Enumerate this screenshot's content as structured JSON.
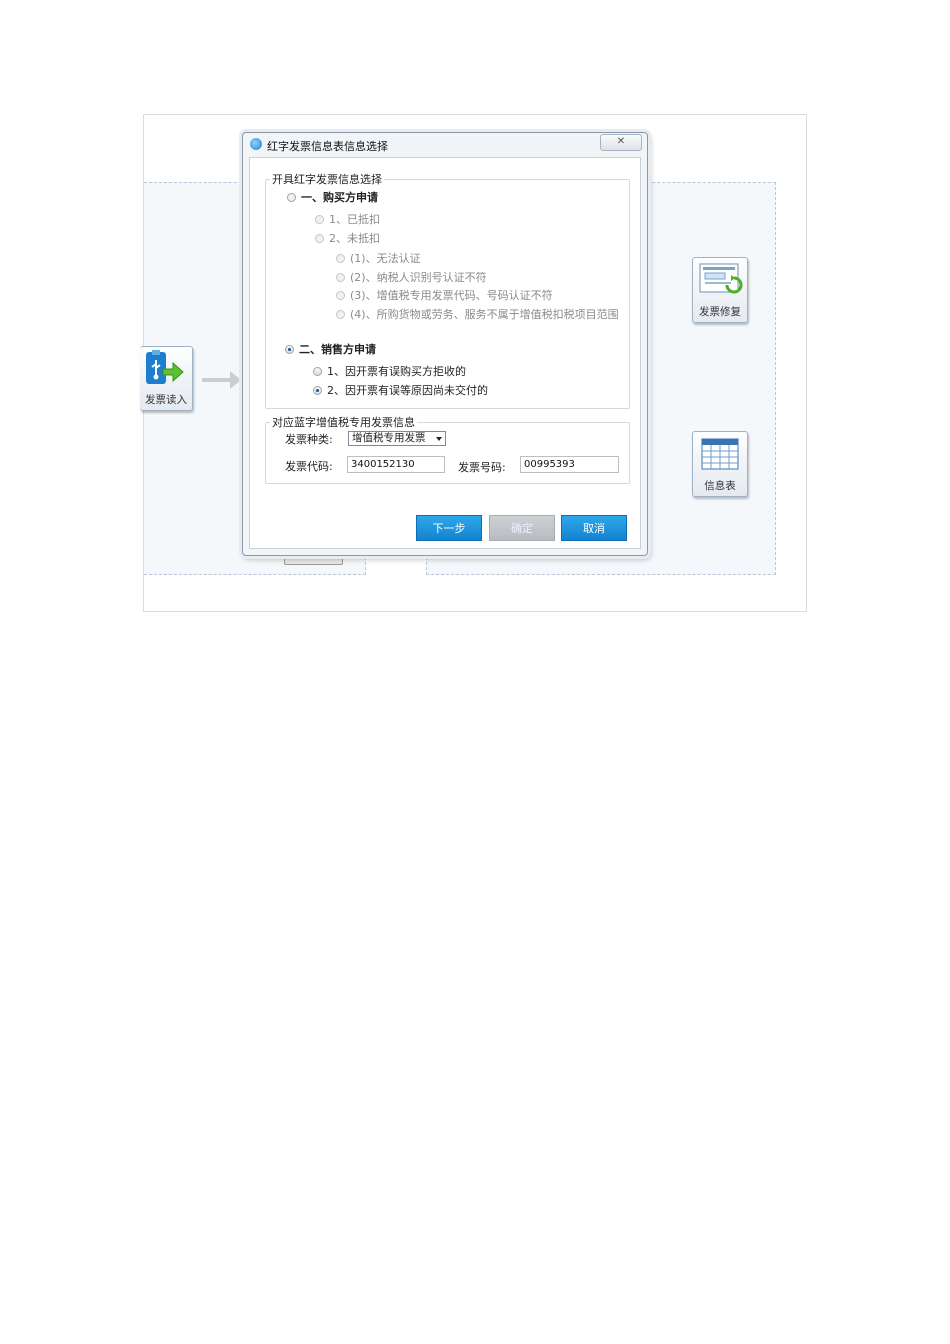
{
  "background": {
    "tiles": [
      {
        "label": "发票读入",
        "icon": "usb-import-icon"
      },
      {
        "label": "发票修复",
        "icon": "invoice-repair-icon"
      },
      {
        "label": "信息表",
        "icon": "table-icon"
      }
    ]
  },
  "dialog": {
    "title": "红字发票信息表信息选择",
    "group1": {
      "legend": "开具红字发票信息选择",
      "buyer": {
        "label": "一、购买方申请",
        "options": [
          "1、已抵扣",
          "2、未抵扣"
        ],
        "sub_options": [
          "(1)、无法认证",
          "(2)、纳税人识别号认证不符",
          "(3)、增值税专用发票代码、号码认证不符",
          "(4)、所购货物或劳务、服务不属于增值税扣税项目范围"
        ]
      },
      "seller": {
        "label": "二、销售方申请",
        "options": [
          "1、因开票有误购买方拒收的",
          "2、因开票有误等原因尚未交付的"
        ]
      }
    },
    "group2": {
      "legend": "对应蓝字增值税专用发票信息",
      "invoice_type_label": "发票种类:",
      "invoice_type_value": "增值税专用发票",
      "invoice_code_label": "发票代码:",
      "invoice_code_value": "3400152130",
      "invoice_number_label": "发票号码:",
      "invoice_number_value": "00995393"
    },
    "buttons": {
      "next": "下一步",
      "confirm": "确定",
      "cancel": "取消"
    }
  }
}
